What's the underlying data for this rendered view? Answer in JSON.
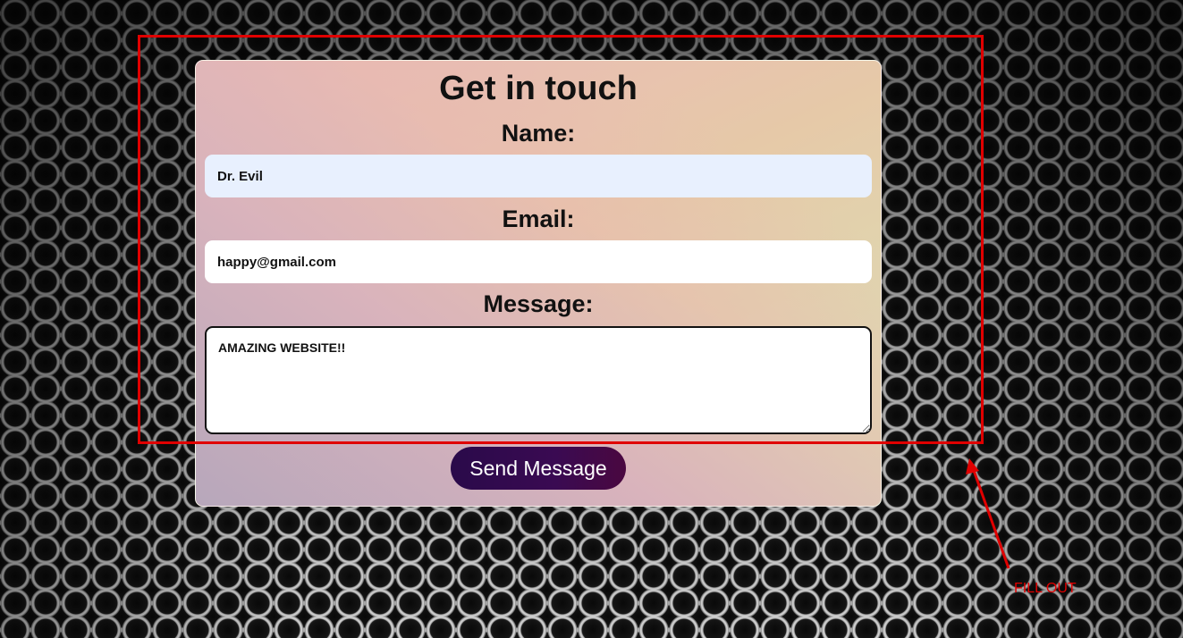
{
  "form": {
    "title": "Get in touch",
    "name_label": "Name:",
    "name_value": "Dr. Evil",
    "email_label": "Email:",
    "email_value": "happy@gmail.com",
    "message_label": "Message:",
    "message_value": "AMAZING WEBSITE!!",
    "send_label": "Send Message"
  },
  "annotation": {
    "label": "FILL OUT",
    "color": "#e00000"
  }
}
